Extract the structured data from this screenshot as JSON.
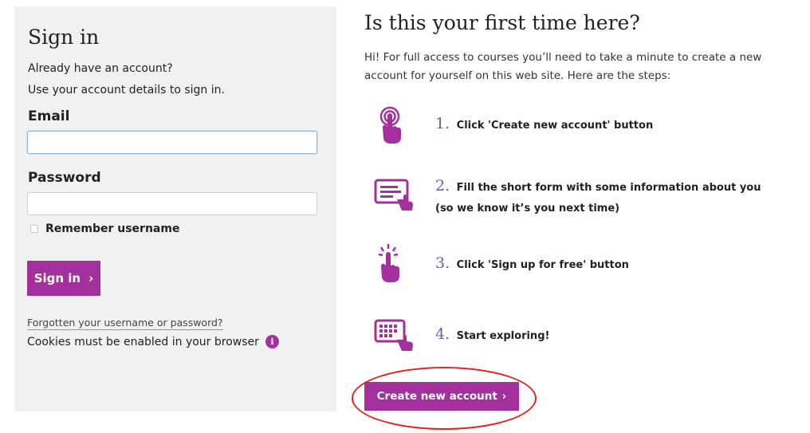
{
  "signin": {
    "title": "Sign in",
    "line1": "Already have an account?",
    "line2": "Use your account details to sign in.",
    "email_label": "Email",
    "email_value": "",
    "password_label": "Password",
    "password_value": "",
    "remember_label": "Remember username",
    "button_label": "Sign in",
    "button_chevron": "›",
    "forgot_link": "Forgotten your username or password?",
    "cookies_text": "Cookies must be enabled in your browser",
    "info_icon_glyph": "i"
  },
  "signup": {
    "title": "Is this your first time here?",
    "intro": "Hi! For full access to courses you’ll need to take a minute to create a new account for yourself on this web site. Here are the steps:",
    "steps": [
      {
        "number": "1.",
        "text": "Click 'Create new account' button",
        "text2": "",
        "icon": "tap-finger-icon"
      },
      {
        "number": "2.",
        "text": "Fill the short form with some information about you",
        "text2": "(so we know it’s you next time)",
        "icon": "form-hand-icon"
      },
      {
        "number": "3.",
        "text": "Click 'Sign up for free' button",
        "text2": "",
        "icon": "click-finger-icon"
      },
      {
        "number": "4.",
        "text": "Start exploring!",
        "text2": "",
        "icon": "keyboard-hand-icon"
      }
    ],
    "create_button": "Create new account",
    "create_chevron": "›"
  },
  "colors": {
    "brand": "#a3309c",
    "step_number": "#6f5bb4",
    "highlight": "#e1221f",
    "panel_bg": "#f1f1f1"
  }
}
